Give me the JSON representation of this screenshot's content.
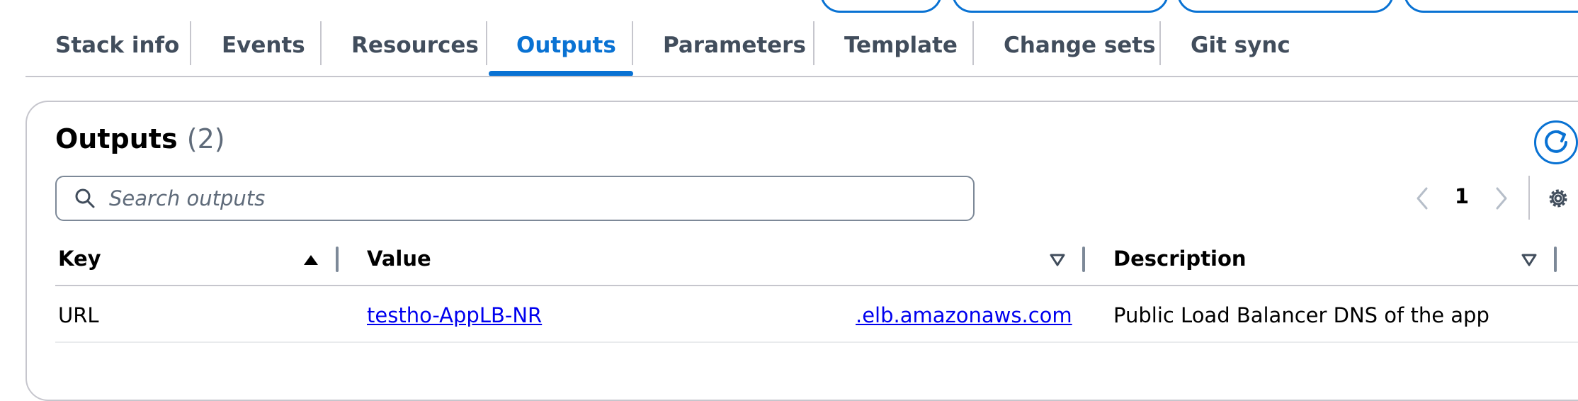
{
  "tabs": [
    {
      "label": "Stack info"
    },
    {
      "label": "Events"
    },
    {
      "label": "Resources"
    },
    {
      "label": "Outputs",
      "active": true
    },
    {
      "label": "Parameters"
    },
    {
      "label": "Template"
    },
    {
      "label": "Change sets"
    },
    {
      "label": "Git sync"
    }
  ],
  "outputs": {
    "title": "Outputs",
    "count": "(2)",
    "search": {
      "placeholder": "Search outputs",
      "value": ""
    },
    "pagination": {
      "current_page": "1"
    },
    "columns": [
      {
        "label": "Key",
        "sort": "ascending"
      },
      {
        "label": "Value",
        "sort": "sortable"
      },
      {
        "label": "Description",
        "sort": "sortable"
      }
    ],
    "rows": [
      {
        "key": "URL",
        "value_start": "testho-AppLB-NR",
        "value_end": ".elb.amazonaws.com",
        "description": "Public Load Balancer DNS of the app"
      }
    ]
  },
  "colors": {
    "accent": "#0972d3",
    "link": "#0000ee",
    "text": "#000000",
    "secondary_text": "#5f6b7a",
    "border": "#c6c6cd"
  },
  "icons": [
    "search-icon",
    "refresh-icon",
    "chevron-left-icon",
    "chevron-right-icon",
    "gear-icon",
    "sort-ascending-icon",
    "sort-descending-icon"
  ]
}
